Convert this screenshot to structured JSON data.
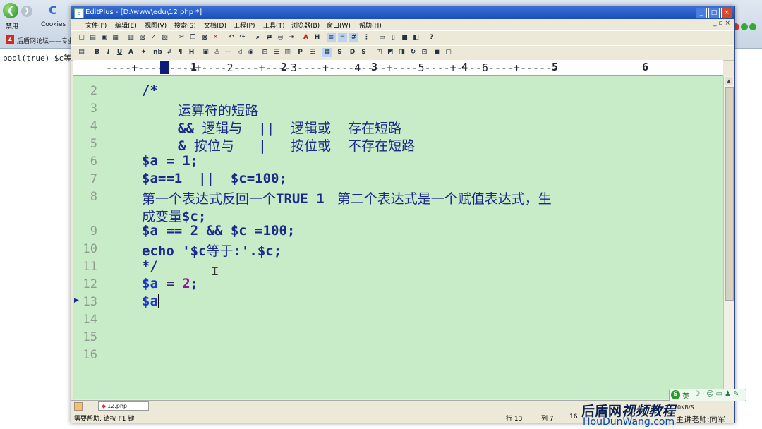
{
  "browser": {
    "back_glyph": "❮",
    "fwd_glyph": "❯",
    "refresh_glyph": "C",
    "toolbar_disabled": "禁用",
    "toolbar_cookies": "Cookies",
    "tab_label": "后盾网论坛——专业",
    "tab_icon_text": "Z",
    "page_text": "bool(true) $c等于"
  },
  "window": {
    "title": "EditPlus - [D:\\www\\edu\\12.php *]",
    "icon_text": "E",
    "minimize": "_",
    "maximize": "□",
    "close": "×",
    "mdi_controls": "_ ▫ ×"
  },
  "menu": {
    "file": "文件(F)",
    "edit": "编辑(E)",
    "view": "视图(V)",
    "search": "搜索(S)",
    "document": "文档(D)",
    "project": "工程(P)",
    "tools": "工具(T)",
    "browser": "浏览器(B)",
    "window": "窗口(W)",
    "help": "帮助(H)"
  },
  "ruler": {
    "dashes": "----+----1----+----2----+----3----+----4----+----5----+----6----+------",
    "marks": [
      "1",
      "2",
      "3",
      "4",
      "5",
      "6"
    ]
  },
  "editor": {
    "line_numbers": [
      "2",
      "3",
      "4",
      "5",
      "6",
      "7",
      "8",
      "",
      "9",
      "10",
      "11",
      "12",
      "13",
      "14",
      "15",
      "16"
    ],
    "lines": {
      "l2": "/*",
      "l3": "运算符的短路",
      "l4a": "&& ",
      "l4b": "逻辑与",
      "l4c": "  ||  ",
      "l4d": "逻辑或    存在短路",
      "l5a": "& ",
      "l5b": "按位与",
      "l5c": "   |   ",
      "l5d": "按位或    不存在短路",
      "l6": "$a = 1;",
      "l7": "$a==1  ||  $c=100;",
      "l8a": "第一个表达式反回一个",
      "l8b": "TRUE 1",
      "l8c": "   第二个表达式是一个赋值表达式，生",
      "l8d": "成变量",
      "l8e": "$c;",
      "l9": "$a == 2 && $c =100;",
      "l10a": "echo '$c",
      "l10b": "等于",
      "l10c": ":'.$c;",
      "l11": "*/",
      "l12_var": "$a",
      "l12_op": " = ",
      "l12_num": "2",
      "l12_end": ";",
      "l13": "$a"
    }
  },
  "tabs": {
    "file_tab": "12.php",
    "dot": "◆"
  },
  "status": {
    "help": "需要帮助, 请按 F1 键",
    "line": "行 13",
    "col": "列 7",
    "num": "16"
  },
  "ime": {
    "logo": "S",
    "lang": "英"
  },
  "overlay": {
    "speed": "0KB/S",
    "wm_title_a": "后盾网",
    "wm_title_b": "视频教程",
    "wm_url": "HouDunWang.com",
    "wm_teacher": "主讲老师:向军"
  }
}
